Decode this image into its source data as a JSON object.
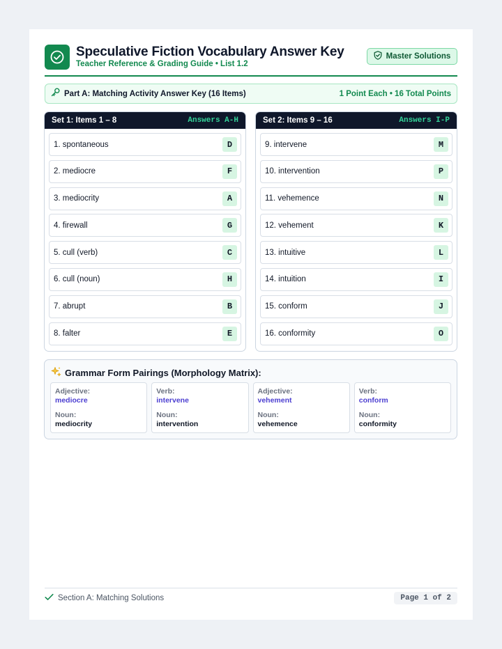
{
  "header": {
    "title": "Speculative Fiction Vocabulary Answer Key",
    "subtitle": "Teacher Reference & Grading Guide • List 1.2",
    "badge": "Master Solutions",
    "logo_icon": "check-circle-icon",
    "badge_icon": "shield-check-icon"
  },
  "part_a": {
    "icon": "key-icon",
    "title": "Part A: Matching Activity Answer Key (16 Items)",
    "points": "1 Point Each • 16 Total Points"
  },
  "sets": [
    {
      "title": "Set 1: Items 1 – 8",
      "range": "Answers A-H",
      "items": [
        {
          "term": "1. spontaneous",
          "answer": "D"
        },
        {
          "term": "2. mediocre",
          "answer": "F"
        },
        {
          "term": "3. mediocrity",
          "answer": "A"
        },
        {
          "term": "4. firewall",
          "answer": "G"
        },
        {
          "term": "5. cull (verb)",
          "answer": "C"
        },
        {
          "term": "6. cull (noun)",
          "answer": "H"
        },
        {
          "term": "7. abrupt",
          "answer": "B"
        },
        {
          "term": "8. falter",
          "answer": "E"
        }
      ]
    },
    {
      "title": "Set 2: Items 9 – 16",
      "range": "Answers I-P",
      "items": [
        {
          "term": "9. intervene",
          "answer": "M"
        },
        {
          "term": "10. intervention",
          "answer": "P"
        },
        {
          "term": "11. vehemence",
          "answer": "N"
        },
        {
          "term": "12. vehement",
          "answer": "K"
        },
        {
          "term": "13. intuitive",
          "answer": "L"
        },
        {
          "term": "14. intuition",
          "answer": "I"
        },
        {
          "term": "15. conform",
          "answer": "J"
        },
        {
          "term": "16. conformity",
          "answer": "O"
        }
      ]
    }
  ],
  "grammar": {
    "icon": "sparkles-icon",
    "title": "Grammar Form Pairings (Morphology Matrix):",
    "pairs": [
      {
        "label1": "Adjective:",
        "word1": "mediocre",
        "label2": "Noun:",
        "word2": "mediocrity"
      },
      {
        "label1": "Verb:",
        "word1": "intervene",
        "label2": "Noun:",
        "word2": "intervention"
      },
      {
        "label1": "Adjective:",
        "word1": "vehement",
        "label2": "Noun:",
        "word2": "vehemence"
      },
      {
        "label1": "Verb:",
        "word1": "conform",
        "label2": "Noun:",
        "word2": "conformity"
      }
    ]
  },
  "footer": {
    "icon": "check-icon",
    "section": "Section A: Matching Solutions",
    "page": "Page 1 of 2"
  },
  "colors": {
    "brand_green": "#12894f",
    "dark_navy": "#0f172a",
    "answer_bg": "#d6f5e2",
    "accent_purple": "#4c3fd1",
    "range_green": "#34d399"
  }
}
